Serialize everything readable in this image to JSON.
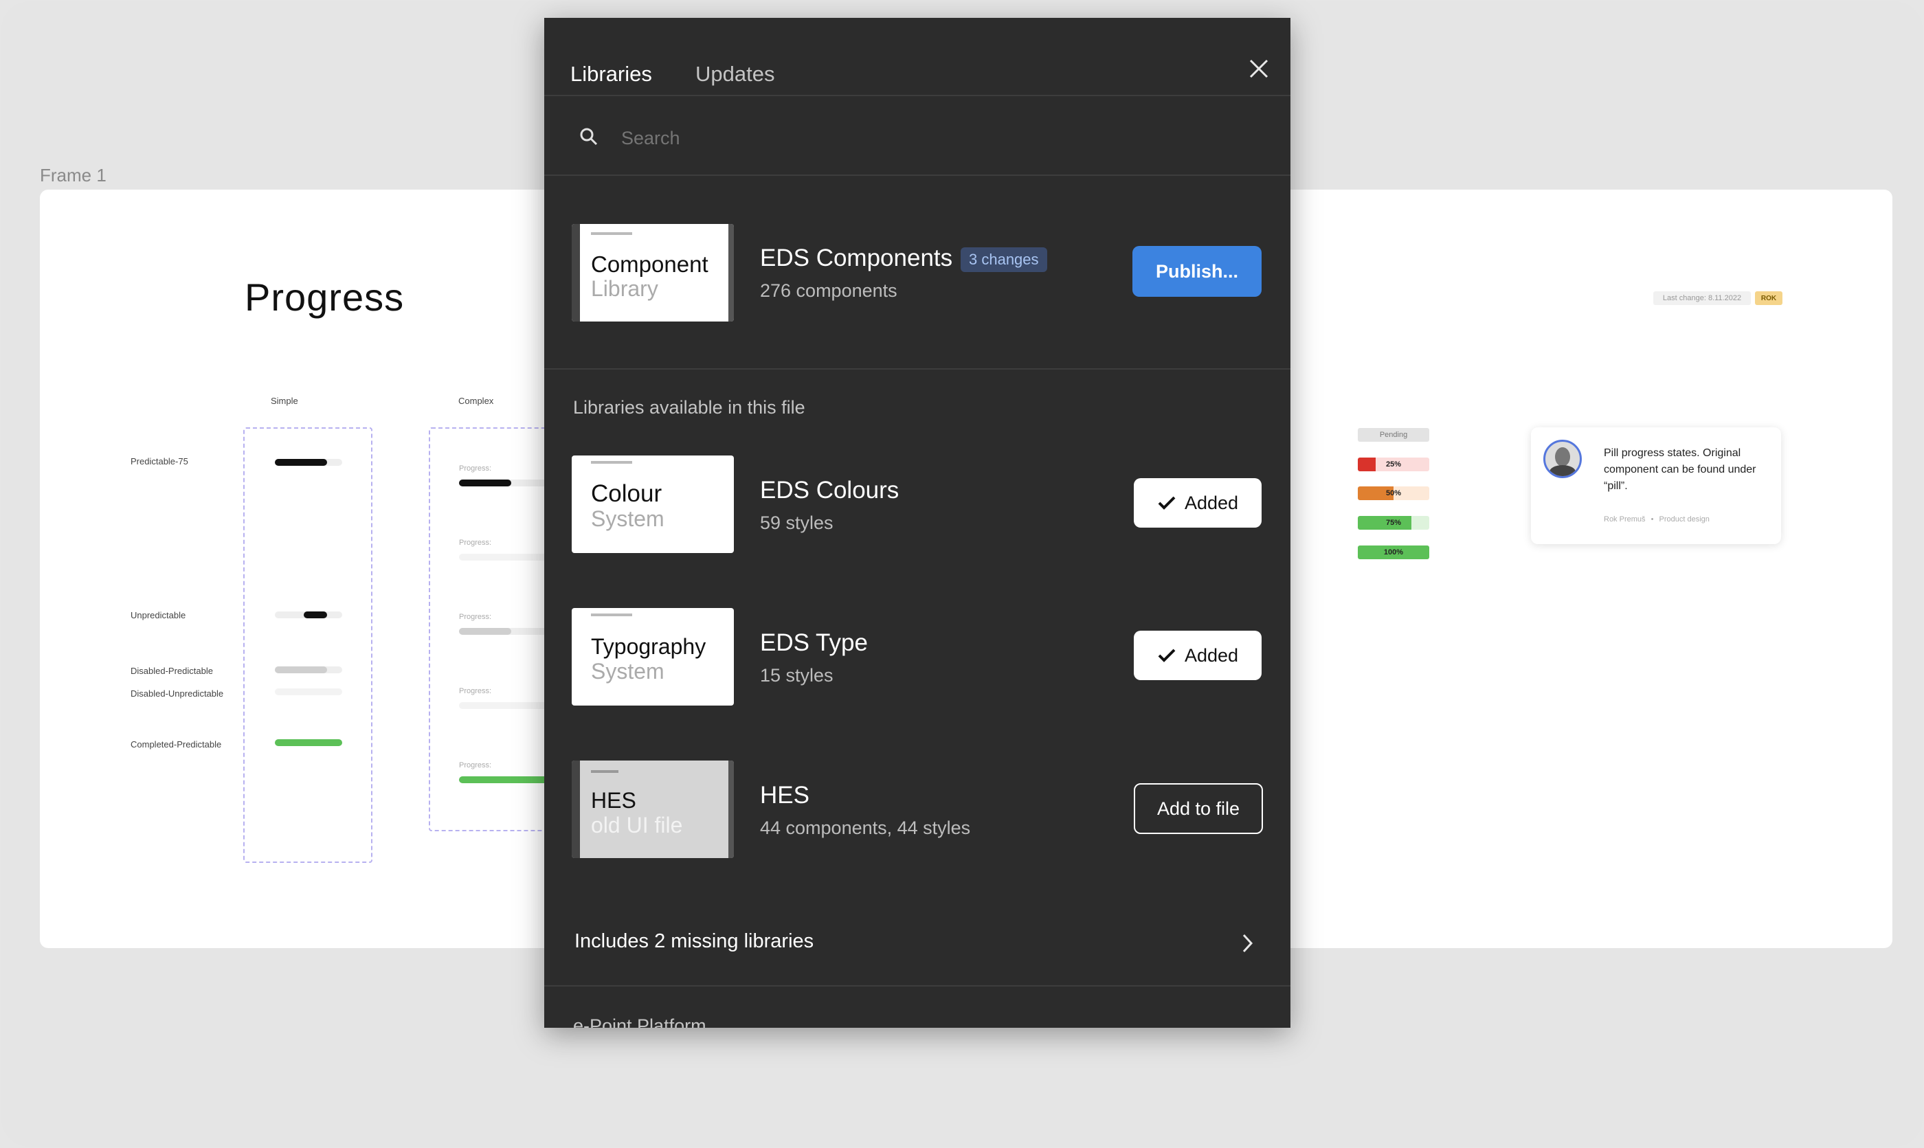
{
  "canvas": {
    "frame_label": "Frame 1",
    "page_title": "Progress",
    "columns": [
      "Simple",
      "Complex"
    ],
    "rows": [
      "Predictable-75",
      "Unpredictable",
      "Disabled-Predictable",
      "Disabled-Unpredictable",
      "Completed-Predictable"
    ],
    "progress_label": "Progress:",
    "last_change": "Last change: 8.11.2022",
    "owner_badge": "ROK",
    "pills": [
      "Pending",
      "25%",
      "50%",
      "75%",
      "100%"
    ],
    "comment": {
      "text": "Pill progress states. Original component can be found under “pill”.",
      "author": "Rok Premuš",
      "role": "Product design"
    }
  },
  "modal": {
    "tabs": [
      "Libraries",
      "Updates"
    ],
    "search_placeholder": "Search",
    "current_library": {
      "thumb_title": "Component",
      "thumb_subtitle": "Library",
      "name": "EDS Components",
      "badge": "3 changes",
      "meta": "276 components",
      "button": "Publish..."
    },
    "section_title": "Libraries available in this file",
    "libraries": [
      {
        "thumb_title": "Colour",
        "thumb_subtitle": "System",
        "name": "EDS Colours",
        "meta": "59 styles",
        "button": "Added"
      },
      {
        "thumb_title": "Typography",
        "thumb_subtitle": "System",
        "name": "EDS Type",
        "meta": "15 styles",
        "button": "Added"
      },
      {
        "thumb_title": "HES",
        "thumb_subtitle": "old UI file",
        "name": "HES",
        "meta": "44 components, 44 styles",
        "button": "Add to file"
      }
    ],
    "missing_libraries": "Includes 2 missing libraries",
    "next_section": "e-Point Platform"
  },
  "colors": {
    "accent": "#3c83e0",
    "modal_bg": "#2c2c2c",
    "badge_bg": "#3a4a6b",
    "pill_red": "#d9332b",
    "pill_orange": "#e08030",
    "pill_green": "#5cc057"
  }
}
